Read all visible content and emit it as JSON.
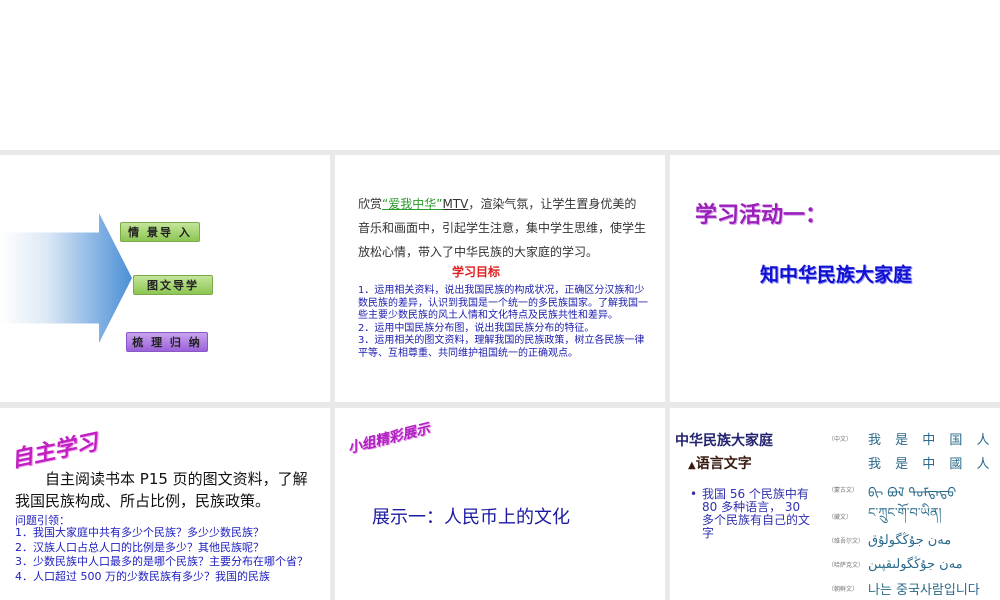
{
  "slide1": {
    "tags": [
      "情 景导 入",
      "图文导学",
      "梳 理 归 纳"
    ]
  },
  "slide2": {
    "intro_prefix": "欣赏",
    "intro_highlight": "“爱我中华”",
    "intro_mtv": "MTV",
    "intro_rest": "，渲染气氛，让学生置身优美的音乐和画面中，引起学生注意，集中学生思维，使学生放松心情，带入了中华民族的大家庭的学习。",
    "goals_title": "学习目标",
    "goals": [
      "1．运用相关资料，说出我国民族的构成状况，正确区分汉族和少数民族的差异，认识到我国是一个统一的多民族国家。了解我国一些主要少数民族的风土人情和文化特点及民族共性和差异。",
      "2．运用中国民族分布图，说出我国民族分布的特征。",
      "3．运用相关的图文资料，理解我国的民族政策，树立各民族一律平等、互相尊重、共同维护祖国统一的正确观点。"
    ]
  },
  "slide3": {
    "title": "学习活动一：",
    "subtitle": "知中华民族大家庭"
  },
  "slide4": {
    "title": "自主学习",
    "intro": "自主阅读书本 P15 页的图文资料，了解我国民族构成、所占比例，民族政策。",
    "questions_title": "问题引领：",
    "questions": [
      "1．我国大家庭中共有多少个民族？多少少数民族？",
      "2．汉族人口占总人口的比例是多少？其他民族呢？",
      "3．少数民族中人口最多的是哪个民族？主要分布在哪个省？",
      "4．人口超过 500 万的少数民族有多少？我国的民族"
    ]
  },
  "slide5": {
    "title": "小组精彩展示",
    "item": "展示一：人民币上的文化"
  },
  "slide6": {
    "title": "中华民族大家庭",
    "subtitle": "语言文字",
    "bullet": "我国 56 个民族中有 80 多种语言， 30 多个民族有自己的文字",
    "scripts": [
      {
        "label": "（中文）",
        "text": "我 是 中 国 人"
      },
      {
        "label": "",
        "text": "我 是 中 國 人"
      },
      {
        "label": "（蒙古文）",
        "text": "ᠪᠢ ᠪᠣᠯ ᠳᠤᠮᠳᠠᠳᠤ"
      },
      {
        "label": "（藏文）",
        "text": "ང་ཀྲུང་གོ་བ་ཡིན།"
      },
      {
        "label": "（维吾尔文）",
        "text": "مەن جۇڭگولۇق"
      },
      {
        "label": "（哈萨克文）",
        "text": "مەن جۇڭگولىقپىن"
      },
      {
        "label": "（朝鲜文）",
        "text": "나는 중국사람입니다"
      }
    ]
  }
}
